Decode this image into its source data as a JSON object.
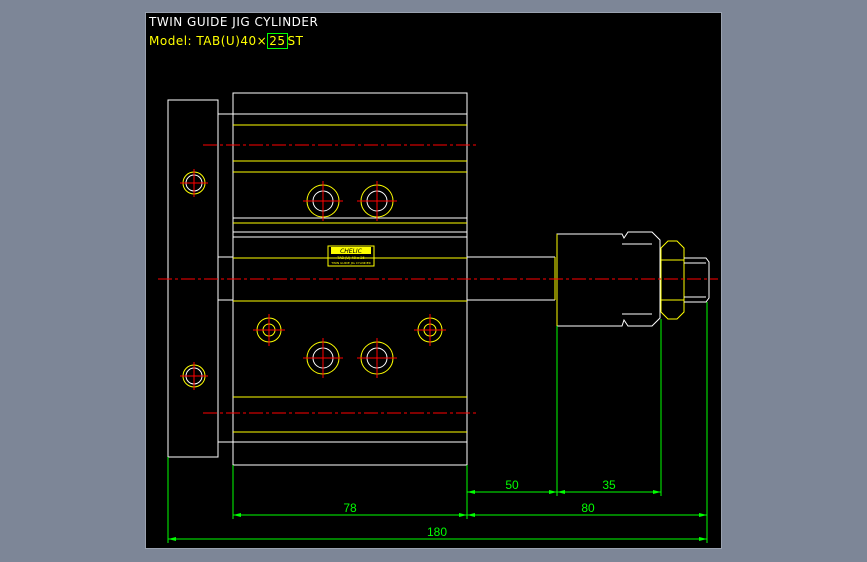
{
  "title": {
    "line1": "TWIN GUIDE JIG CYLINDER",
    "model_label": "Model:",
    "model_prefix": "TAB(U)40",
    "model_times": "×",
    "model_stroke": "25",
    "model_suffix": "ST"
  },
  "nameplate": {
    "brand": "CHELIC",
    "line2": "TAB (U) 40 x 25",
    "line3": "TWIN GUIDE JIG CYLINDER"
  },
  "dimensions": {
    "d50": "50",
    "d35": "35",
    "d78": "78",
    "d80": "80",
    "d180": "180"
  },
  "colors": {
    "background": "#7d8697",
    "canvas": "#000000",
    "outline": "#ffffff",
    "yellow_lines": "#ffff00",
    "centerline": "#ff0000",
    "dimension": "#00ff00",
    "title_text": "#ffffff",
    "model_text": "#ffff00"
  }
}
